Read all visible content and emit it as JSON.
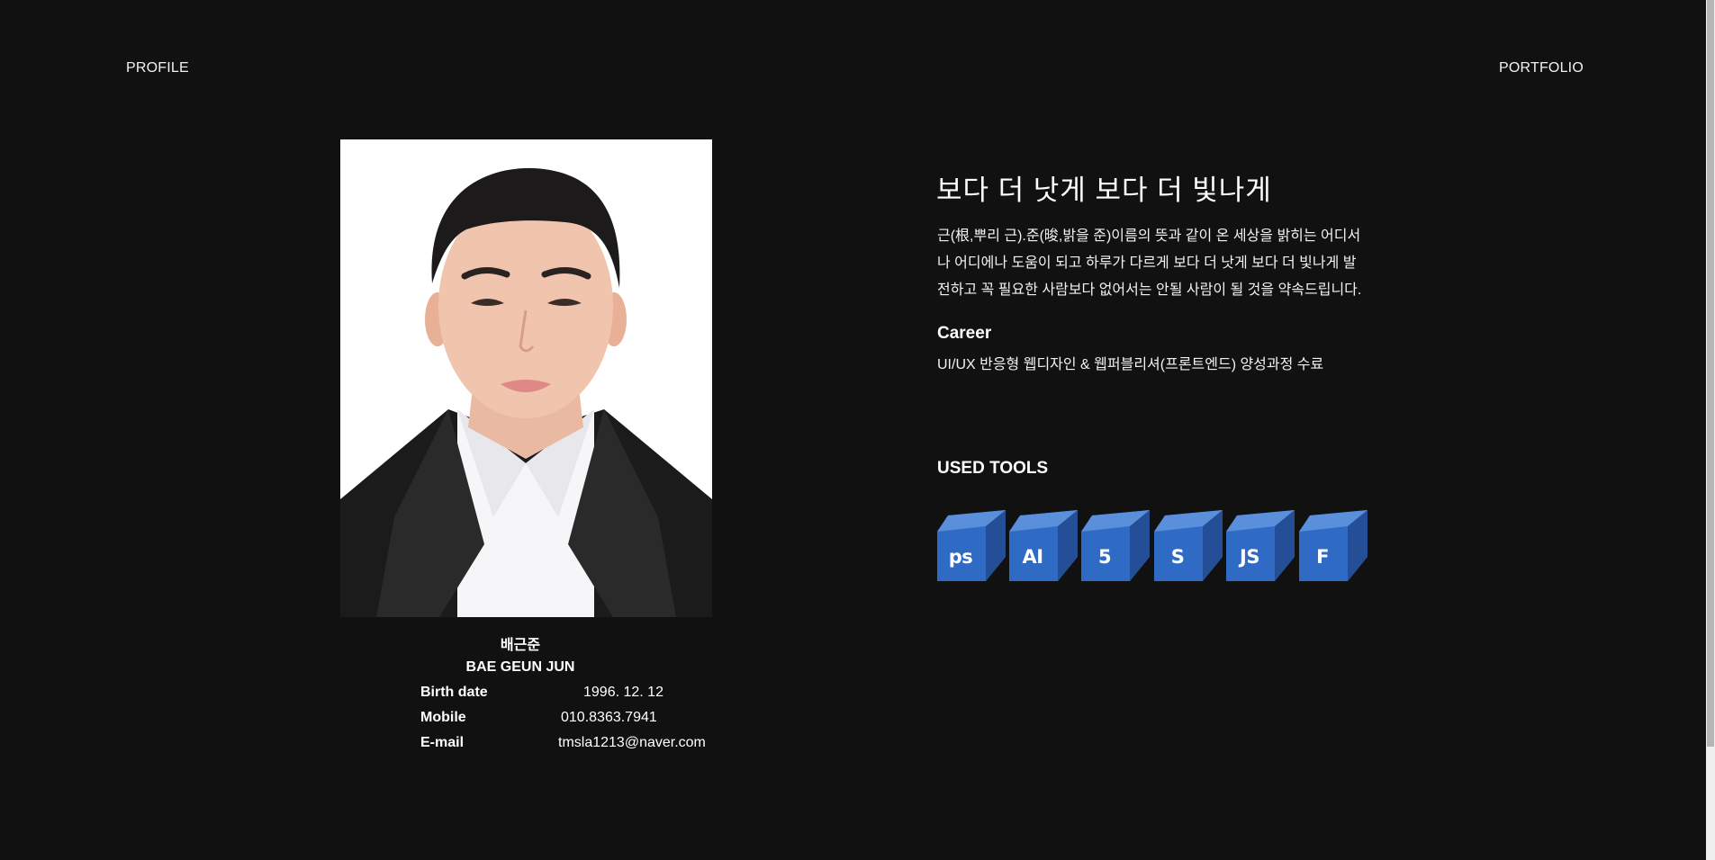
{
  "nav": {
    "profile": "PROFILE",
    "portfolio": "PORTFOLIO"
  },
  "profile": {
    "name_kr": "배근준",
    "name_en": "BAE GEUN JUN",
    "info": [
      {
        "label": "Birth date",
        "value": "1996. 12. 12"
      },
      {
        "label": "Mobile",
        "value": "010.8363.7941"
      },
      {
        "label": "E-mail",
        "value": "tmsla1213@naver.com"
      }
    ]
  },
  "about": {
    "headline": "보다 더 낫게 보다 더 빛나게",
    "intro": "근(根,뿌리 근).준(晙,밝을 준)이름의 뜻과 같이 온 세상을 밝히는 어디서나 어디에나 도움이 되고 하루가 다르게 보다 더 낫게 보다 더 빛나게 발전하고 꼭 필요한 사람보다 없어서는 안될 사람이 될 것을 약속드립니다.",
    "career_title": "Career",
    "career_text": "UI/UX 반응형 웹디자인 & 웹퍼블리셔(프론트엔드) 양성과정 수료"
  },
  "tools": {
    "title": "USED TOOLS",
    "items": [
      {
        "label": "ps",
        "icon": "photoshop-icon"
      },
      {
        "label": "AI",
        "icon": "illustrator-icon"
      },
      {
        "label": "5",
        "icon": "html5-icon"
      },
      {
        "label": "S",
        "icon": "sass-icon"
      },
      {
        "label": "JS",
        "icon": "javascript-icon"
      },
      {
        "label": "F",
        "icon": "figma-icon"
      }
    ],
    "color": "#2f6bc4"
  },
  "colors": {
    "background": "#111111",
    "text": "#ffffff"
  }
}
